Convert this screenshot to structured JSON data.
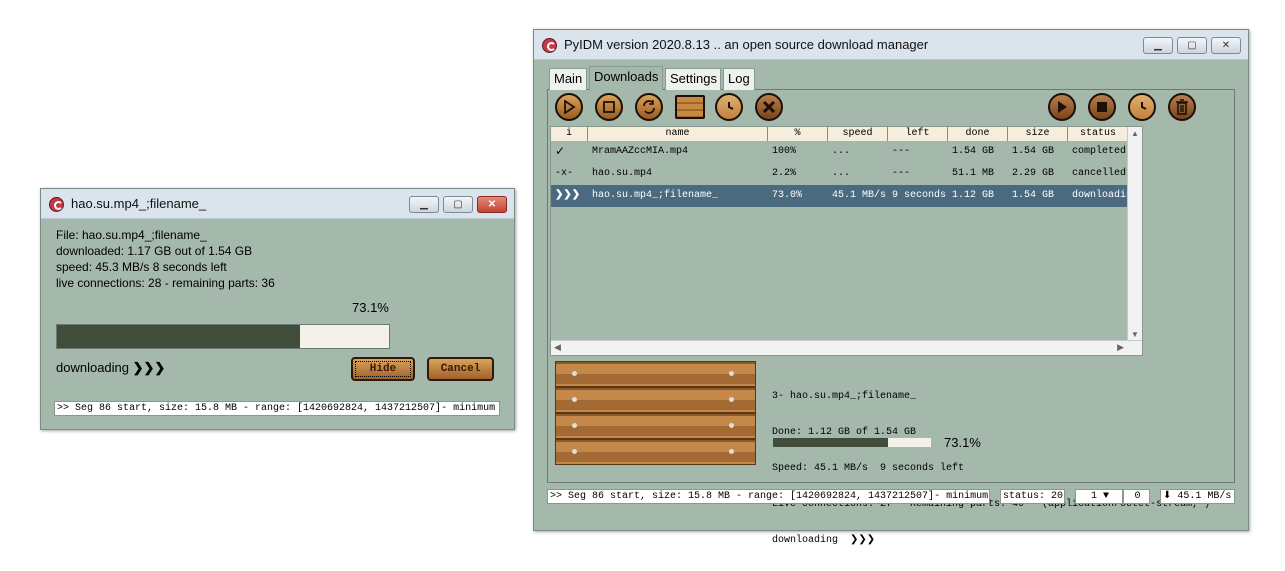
{
  "popup": {
    "title": "hao.su.mp4_;filename_",
    "file_line": "File: hao.su.mp4_;filename_",
    "downloaded_line": "downloaded: 1.17 GB out of 1.54 GB",
    "speed_line": "speed: 45.3 MB/s  8 seconds left",
    "connections_line": "live connections: 28 - remaining parts: 36",
    "percent_text": "73.1%",
    "progress": 0.731,
    "status_text": "downloading",
    "status_arrows": "❯❯❯",
    "hide_label": "Hide",
    "cancel_label": "Cancel",
    "log_line": ">> Seg 86 start, size: 15.8 MB - range: [1420692824, 1437212507]- minimum"
  },
  "main": {
    "title": "PyIDM version 2020.8.13 .. an open source download manager",
    "tabs": [
      "Main",
      "Downloads",
      "Settings",
      "Log"
    ],
    "active_tab": "Downloads",
    "toolbar_left_icons": [
      "resume-icon",
      "stop-icon",
      "refresh-icon",
      "folder-icon",
      "schedule-icon",
      "delete-icon"
    ],
    "toolbar_right_icons": [
      "resume-all-icon",
      "stop-all-icon",
      "schedule-all-icon",
      "delete-all-icon"
    ],
    "columns": [
      "i",
      "name",
      "%",
      "speed",
      "left",
      "done",
      "size",
      "status"
    ],
    "rows": [
      {
        "i": "✓",
        "name": "MramAAZccMIA.mp4",
        "pct": "100%",
        "speed": "...",
        "left": "---",
        "done": "1.54 GB",
        "size": "1.54 GB",
        "status": "completed",
        "selected": false
      },
      {
        "i": "-x-",
        "name": "hao.su.mp4",
        "pct": "2.2%",
        "speed": "...",
        "left": "---",
        "done": "51.1 MB",
        "size": "2.29 GB",
        "status": "cancelled",
        "selected": false
      },
      {
        "i": "❯❯❯",
        "name": "hao.su.mp4_;filename_",
        "pct": "73.0%",
        "speed": "45.1 MB/s",
        "left": "9 seconds",
        "done": "1.12 GB",
        "size": "1.54 GB",
        "status": "downloading",
        "selected": true
      }
    ],
    "details": {
      "line1": "3- hao.su.mp4_;filename_",
      "line2": "Done: 1.12 GB of 1.54 GB",
      "line3": "Speed: 45.1 MB/s  9 seconds left",
      "line4": "Live connections: 27 - Remaining parts: 40 - (application/octet-stream, )",
      "line5": "downloading  ❯❯❯",
      "percent_text": "73.1%",
      "progress": 0.731
    },
    "statusbar": {
      "log": ">> Seg 86 start, size: 15.8 MB - range: [1420692824, 1437212507]- minimum",
      "status": "status: 20",
      "spin": "1 ▼",
      "count": "0",
      "speed": "⬇ 45.1 MB/s"
    }
  },
  "colors": {
    "window_bg": "#a4b8ac",
    "selected_row": "#4a6a80",
    "progress_fill": "#3f4d3a",
    "wood": "#b5793c"
  }
}
